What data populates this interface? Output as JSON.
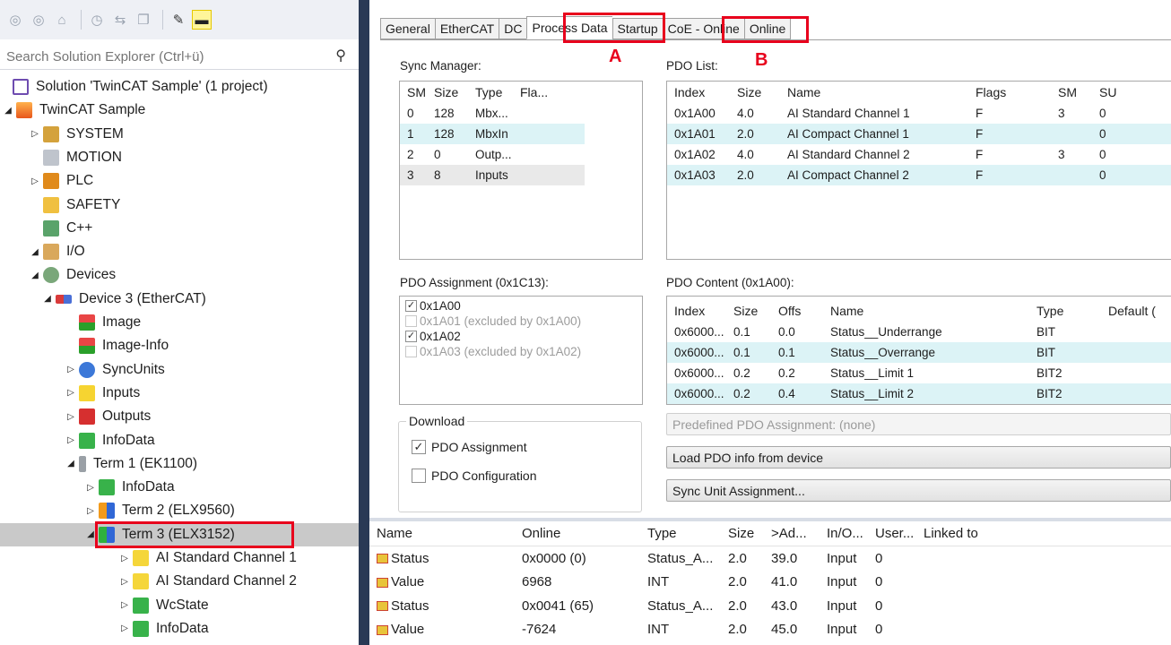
{
  "solution_explorer": {
    "search_placeholder": "Search Solution Explorer (Ctrl+ü)",
    "toolbar_icons": [
      "back-icon",
      "forward-icon",
      "home-icon",
      "history-icon",
      "sync-icon",
      "collapse-icon",
      "wrench-icon",
      "pin-icon"
    ],
    "tree": [
      {
        "label": "Solution 'TwinCAT Sample' (1 project)",
        "icon": "solution-icon",
        "level": 0,
        "arrow": ""
      },
      {
        "label": "TwinCAT Sample",
        "icon": "project-icon",
        "level": 1,
        "arrow": "◢"
      },
      {
        "label": "SYSTEM",
        "icon": "system-icon",
        "level": 2,
        "arrow": "▷"
      },
      {
        "label": "MOTION",
        "icon": "motion-icon",
        "level": 2,
        "arrow": ""
      },
      {
        "label": "PLC",
        "icon": "plc-icon",
        "level": 2,
        "arrow": "▷"
      },
      {
        "label": "SAFETY",
        "icon": "safety-icon",
        "level": 2,
        "arrow": ""
      },
      {
        "label": "C++",
        "icon": "cpp-icon",
        "level": 2,
        "arrow": ""
      },
      {
        "label": "I/O",
        "icon": "io-icon",
        "level": 2,
        "arrow": "◢"
      },
      {
        "label": "Devices",
        "icon": "devices-icon",
        "level": 3,
        "arrow": "◢"
      },
      {
        "label": "Device 3 (EtherCAT)",
        "icon": "ethercat-device-icon",
        "level": 4,
        "arrow": "◢"
      },
      {
        "label": "Image",
        "icon": "image-icon",
        "level": 5,
        "arrow": ""
      },
      {
        "label": "Image-Info",
        "icon": "image-info-icon",
        "level": 5,
        "arrow": ""
      },
      {
        "label": "SyncUnits",
        "icon": "syncunits-icon",
        "level": 5,
        "arrow": "▷"
      },
      {
        "label": "Inputs",
        "icon": "inputs-icon",
        "level": 5,
        "arrow": "▷"
      },
      {
        "label": "Outputs",
        "icon": "outputs-icon",
        "level": 5,
        "arrow": "▷"
      },
      {
        "label": "InfoData",
        "icon": "infodata-icon",
        "level": 5,
        "arrow": "▷"
      },
      {
        "label": "Term 1 (EK1100)",
        "icon": "term1-icon",
        "level": 5,
        "arrow": "◢"
      },
      {
        "label": "InfoData",
        "icon": "infodata-icon",
        "level": 6,
        "arrow": "▷"
      },
      {
        "label": "Term 2 (ELX9560)",
        "icon": "term2-icon",
        "level": 6,
        "arrow": "▷"
      },
      {
        "label": "Term 3 (ELX3152)",
        "icon": "term3-icon",
        "level": 6,
        "arrow": "◢",
        "selected": true
      },
      {
        "label": "AI Standard Channel 1",
        "icon": "channel-icon",
        "level": 7,
        "arrow": "▷"
      },
      {
        "label": "AI Standard Channel 2",
        "icon": "channel-icon",
        "level": 7,
        "arrow": "▷"
      },
      {
        "label": "WcState",
        "icon": "wcstate-icon",
        "level": 7,
        "arrow": "▷"
      },
      {
        "label": "InfoData",
        "icon": "infodata-icon",
        "level": 7,
        "arrow": "▷"
      }
    ]
  },
  "tabs": [
    {
      "label": "General"
    },
    {
      "label": "EtherCAT"
    },
    {
      "label": "DC"
    },
    {
      "label": "Process Data",
      "active": true
    },
    {
      "label": "Startup"
    },
    {
      "label": "CoE - Online"
    },
    {
      "label": "Online"
    }
  ],
  "annotations": {
    "a": "A",
    "b": "B"
  },
  "sync_manager": {
    "label": "Sync Manager:",
    "columns": [
      "SM",
      "Size",
      "Type",
      "Fla..."
    ],
    "rows": [
      [
        "0",
        "128",
        "Mbx...",
        ""
      ],
      [
        "1",
        "128",
        "MbxIn",
        ""
      ],
      [
        "2",
        "0",
        "Outp...",
        ""
      ],
      [
        "3",
        "8",
        "Inputs",
        ""
      ]
    ]
  },
  "pdo_list": {
    "label": "PDO List:",
    "columns": [
      "Index",
      "Size",
      "Name",
      "Flags",
      "SM",
      "SU"
    ],
    "rows": [
      [
        "0x1A00",
        "4.0",
        "AI Standard Channel 1",
        "F",
        "3",
        "0"
      ],
      [
        "0x1A01",
        "2.0",
        "AI Compact Channel 1",
        "F",
        "",
        "0"
      ],
      [
        "0x1A02",
        "4.0",
        "AI Standard Channel 2",
        "F",
        "3",
        "0"
      ],
      [
        "0x1A03",
        "2.0",
        "AI Compact Channel 2",
        "F",
        "",
        "0"
      ]
    ]
  },
  "pdo_assignment": {
    "label": "PDO Assignment (0x1C13):",
    "items": [
      {
        "label": "0x1A00",
        "checked": true,
        "disabled": false
      },
      {
        "label": "0x1A01 (excluded by 0x1A00)",
        "checked": false,
        "disabled": true
      },
      {
        "label": "0x1A02",
        "checked": true,
        "disabled": false
      },
      {
        "label": "0x1A03 (excluded by 0x1A02)",
        "checked": false,
        "disabled": true
      }
    ]
  },
  "pdo_content": {
    "label": "PDO Content (0x1A00):",
    "columns": [
      "Index",
      "Size",
      "Offs",
      "Name",
      "Type",
      "Default ("
    ],
    "rows": [
      [
        "0x6000...",
        "0.1",
        "0.0",
        "Status__Underrange",
        "BIT",
        ""
      ],
      [
        "0x6000...",
        "0.1",
        "0.1",
        "Status__Overrange",
        "BIT",
        ""
      ],
      [
        "0x6000...",
        "0.2",
        "0.2",
        "Status__Limit 1",
        "BIT2",
        ""
      ],
      [
        "0x6000...",
        "0.2",
        "0.4",
        "Status__Limit 2",
        "BIT2",
        ""
      ]
    ]
  },
  "download": {
    "legend": "Download",
    "pdo_assignment": {
      "label": "PDO Assignment",
      "checked": true
    },
    "pdo_configuration": {
      "label": "PDO Configuration",
      "checked": false
    }
  },
  "buttons": {
    "predefined": "Predefined PDO Assignment: (none)",
    "load": "Load PDO info from device",
    "sync_unit": "Sync Unit Assignment..."
  },
  "variables": {
    "columns": [
      "Name",
      "Online",
      "Type",
      "Size",
      ">Ad...",
      "In/O...",
      "User...",
      "Linked to"
    ],
    "rows": [
      [
        "Status",
        "0x0000 (0)",
        "Status_A...",
        "2.0",
        "39.0",
        "Input",
        "0",
        ""
      ],
      [
        "Value",
        "6968",
        "INT",
        "2.0",
        "41.0",
        "Input",
        "0",
        ""
      ],
      [
        "Status",
        "0x0041 (65)",
        "Status_A...",
        "2.0",
        "43.0",
        "Input",
        "0",
        ""
      ],
      [
        "Value",
        "-7624",
        "INT",
        "2.0",
        "45.0",
        "Input",
        "0",
        ""
      ]
    ]
  },
  "colors": {
    "highlight": "#e8001c",
    "splitter": "#293955",
    "row_alt": "#dcf3f6"
  }
}
